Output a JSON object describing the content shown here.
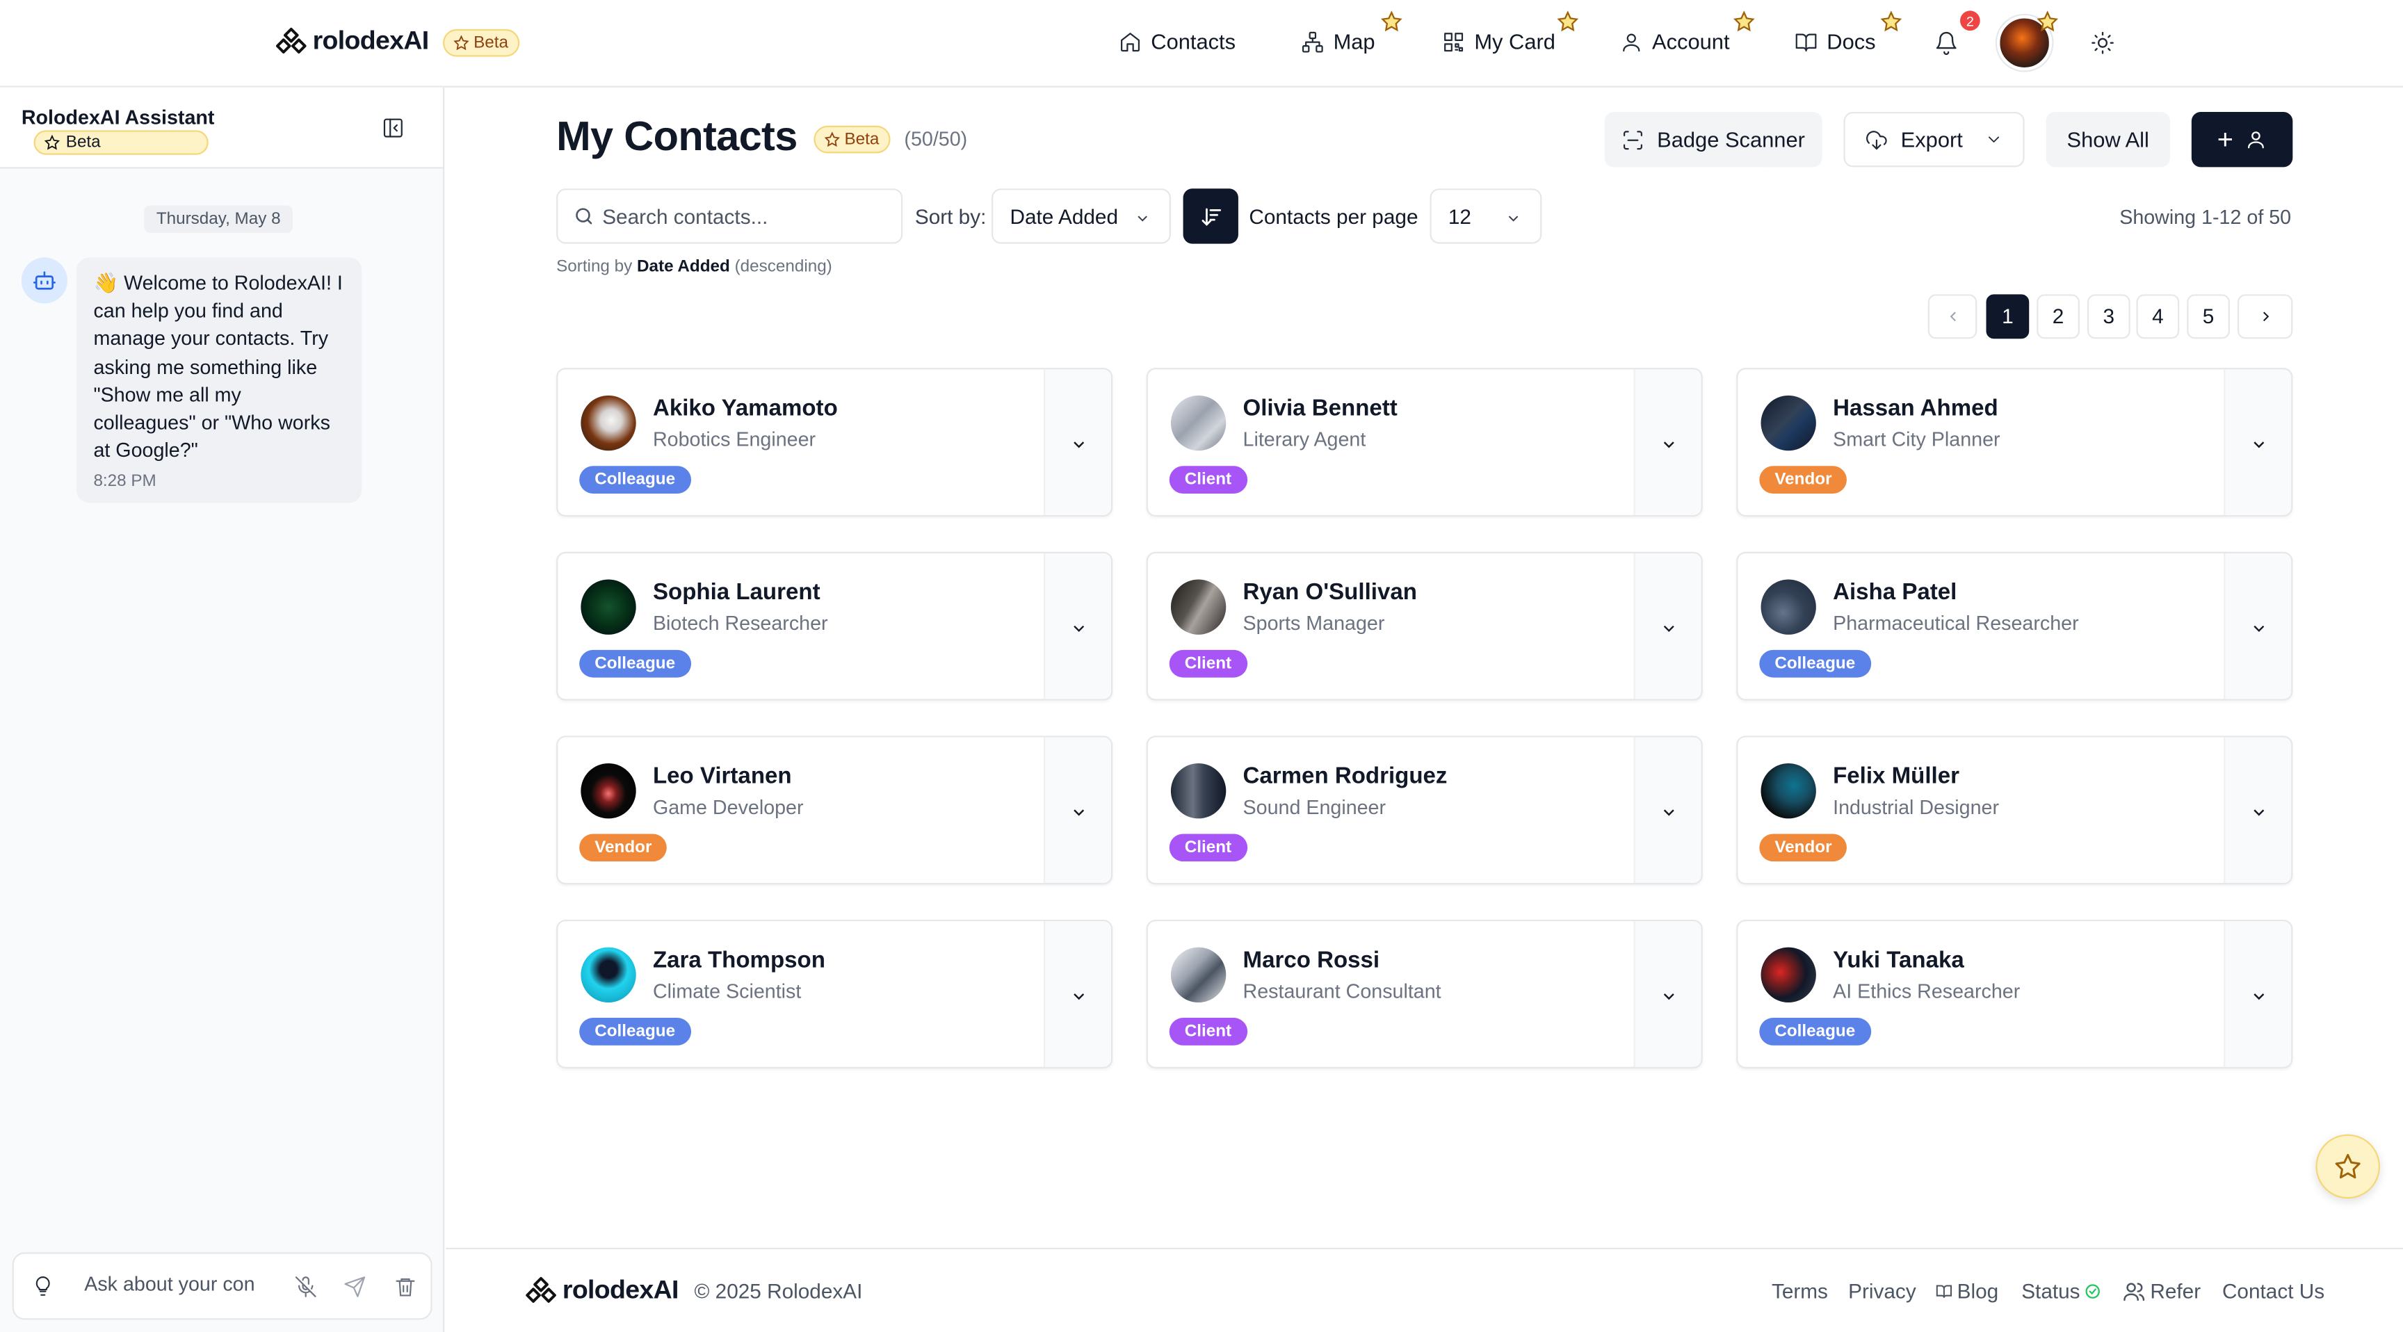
{
  "brand": {
    "name": "rolodexAI",
    "beta": "Beta"
  },
  "nav": {
    "contacts": "Contacts",
    "map": "Map",
    "my_card": "My Card",
    "account": "Account",
    "docs": "Docs",
    "notification_count": "2"
  },
  "assistant": {
    "title": "RolodexAI Assistant",
    "beta": "Beta",
    "date": "Thursday, May 8",
    "message": "👋 Welcome to RolodexAI! I can help you find and manage your contacts. Try asking me something like \"Show me all my colleagues\" or \"Who works at Google?\"",
    "time": "8:28 PM",
    "input_placeholder": "Ask about your con"
  },
  "page": {
    "title": "My Contacts",
    "beta": "Beta",
    "count": "(50/50)",
    "badge_scanner": "Badge Scanner",
    "export": "Export",
    "show_all": "Show All",
    "add_button": "+"
  },
  "controls": {
    "search_placeholder": "Search contacts...",
    "sort_label": "Sort by:",
    "sort_value": "Date Added",
    "per_page_label": "Contacts per page",
    "per_page_value": "12",
    "sorting_prefix": "Sorting by",
    "sorting_field": "Date Added",
    "sorting_suffix": "(descending)",
    "showing": "Showing 1-12 of 50"
  },
  "pagination": {
    "pages": [
      "1",
      "2",
      "3",
      "4",
      "5"
    ],
    "active": "1"
  },
  "contacts": [
    {
      "name": "Akiko Yamamoto",
      "role": "Robotics Engineer",
      "tag": "Colleague"
    },
    {
      "name": "Olivia Bennett",
      "role": "Literary Agent",
      "tag": "Client"
    },
    {
      "name": "Hassan Ahmed",
      "role": "Smart City Planner",
      "tag": "Vendor"
    },
    {
      "name": "Sophia Laurent",
      "role": "Biotech Researcher",
      "tag": "Colleague"
    },
    {
      "name": "Ryan O'Sullivan",
      "role": "Sports Manager",
      "tag": "Client"
    },
    {
      "name": "Aisha Patel",
      "role": "Pharmaceutical Researcher",
      "tag": "Colleague"
    },
    {
      "name": "Leo Virtanen",
      "role": "Game Developer",
      "tag": "Vendor"
    },
    {
      "name": "Carmen Rodriguez",
      "role": "Sound Engineer",
      "tag": "Client"
    },
    {
      "name": "Felix Müller",
      "role": "Industrial Designer",
      "tag": "Vendor"
    },
    {
      "name": "Zara Thompson",
      "role": "Climate Scientist",
      "tag": "Colleague"
    },
    {
      "name": "Marco Rossi",
      "role": "Restaurant Consultant",
      "tag": "Client"
    },
    {
      "name": "Yuki Tanaka",
      "role": "AI Ethics Researcher",
      "tag": "Colleague"
    }
  ],
  "footer": {
    "brand": "rolodexAI",
    "copyright": "© 2025 RolodexAI",
    "terms": "Terms",
    "privacy": "Privacy",
    "blog": "Blog",
    "status": "Status",
    "refer": "Refer",
    "contact": "Contact Us"
  },
  "colors": {
    "colleague": "#5b82e8",
    "client": "#a855f7",
    "vendor": "#f08a3a",
    "primary_dark": "#0f172a",
    "beta_bg": "#fdf3c7"
  }
}
